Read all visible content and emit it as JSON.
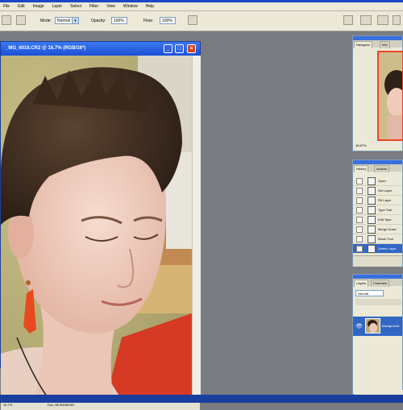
{
  "menubar": {
    "items": [
      "File",
      "Edit",
      "Image",
      "Layer",
      "Select",
      "Filter",
      "View",
      "Window",
      "Help"
    ]
  },
  "options": {
    "mode_label": "Mode:",
    "mode_value": "Normal",
    "opacity_label": "Opacity:",
    "opacity_value": "100%",
    "flow_label": "Flow:",
    "flow_value": "100%"
  },
  "document": {
    "title": "_MG_6016.CR2 @ 16.7% (RGB/16*)",
    "zoom": "16.7%",
    "doc_size": "Doc: 68.9M/68.9M"
  },
  "navigator": {
    "tabs": [
      "Navigator",
      "Info"
    ],
    "zoom": "16.67%"
  },
  "history": {
    "tabs": [
      "History",
      "Actions"
    ],
    "items": [
      "Open",
      "Set Layer",
      "Fill Layer",
      "Type Tool",
      "Edit Type",
      "Merge Down",
      "Brush Tool",
      "Delete Layer"
    ],
    "selected_index": 7
  },
  "layers": {
    "tabs": [
      "Layers",
      "Channels"
    ],
    "blend_mode": "Normal",
    "layer_name": "Background"
  },
  "colors": {
    "accent": "#1c46c8",
    "panel_bg": "#ece9d8",
    "workspace": "#797c80",
    "selection": "#3166c5"
  }
}
